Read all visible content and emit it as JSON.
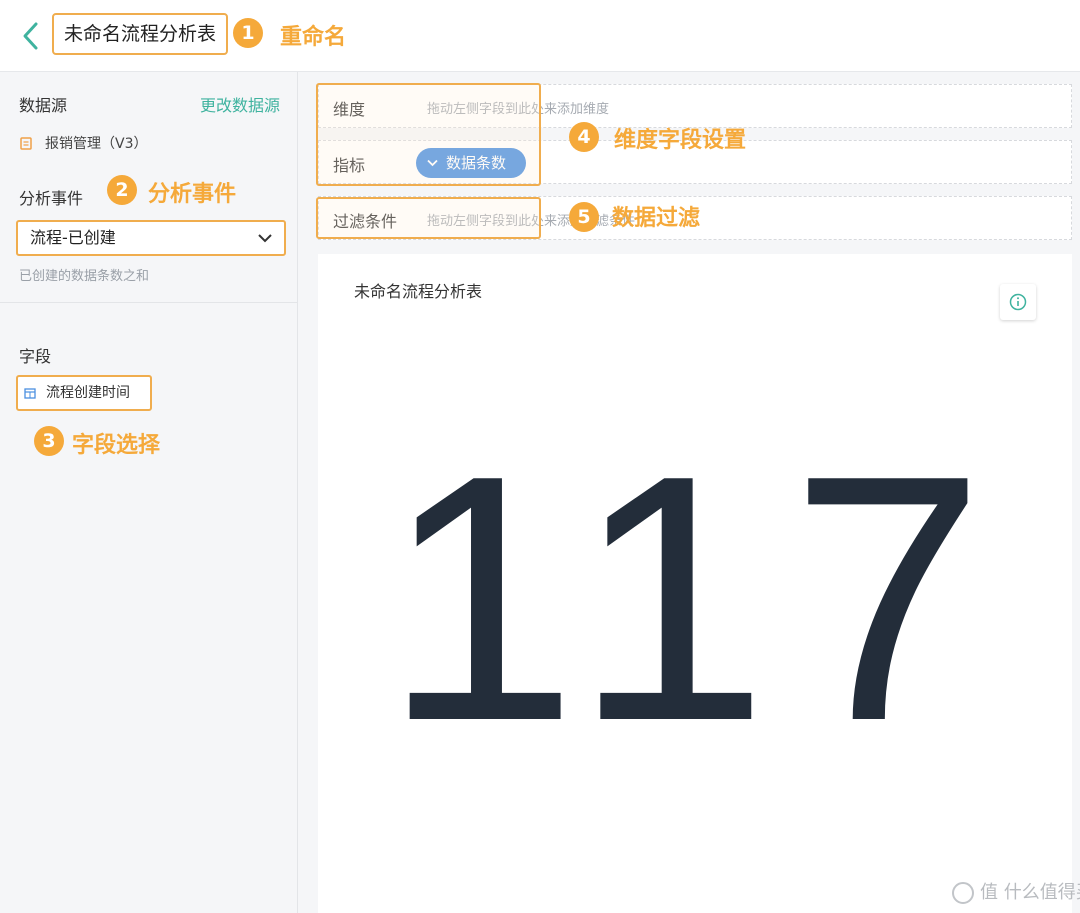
{
  "header": {
    "title": "未命名流程分析表"
  },
  "annotations": {
    "a1": {
      "num": "1",
      "text": "重命名"
    },
    "a2": {
      "num": "2",
      "text": "分析事件"
    },
    "a3": {
      "num": "3",
      "text": "字段选择"
    },
    "a4": {
      "num": "4",
      "text": "维度字段设置"
    },
    "a5": {
      "num": "5",
      "text": "数据过滤"
    }
  },
  "sidebar": {
    "datasource_label": "数据源",
    "change_link": "更改数据源",
    "datasource_item": "报销管理（V3）",
    "event_label": "分析事件",
    "event_value": "流程-已创建",
    "event_hint": "已创建的数据条数之和",
    "fields_label": "字段",
    "field_item": "流程创建时间"
  },
  "config": {
    "dimension_label": "维度",
    "dimension_hint": "拖动左侧字段到此处来添加维度",
    "metric_label": "指标",
    "metric_pill": "数据条数",
    "filter_label": "过滤条件",
    "filter_hint": "拖动左侧字段到此处来添加过滤条件"
  },
  "card": {
    "title": "未命名流程分析表",
    "value": "117"
  },
  "watermark": "值 什么值得买",
  "colors": {
    "accent": "#3fb39f",
    "highlight": "#f0ad4e",
    "badge": "#f5a93a",
    "pill": "#4a8fe0",
    "number": "#232d3a"
  }
}
